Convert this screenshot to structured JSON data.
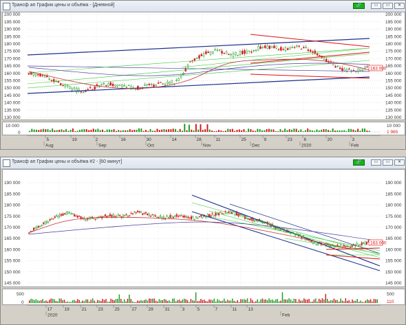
{
  "window1": {
    "title": "Трансф ап График цены и объёма - [Дневной]",
    "buttons": {
      "link": "🔗",
      "min": "▭",
      "restore": "▭",
      "close": "✕"
    },
    "price_ticks": [
      "200 000",
      "195 000",
      "190 000",
      "185 000",
      "180 000",
      "175 000",
      "170 000",
      "165 000",
      "160 000",
      "155 000",
      "150 000",
      "145 000",
      "140 000",
      "135 000",
      "130 000"
    ],
    "price_tag": "163 000",
    "volume_ticks": [
      "10 000",
      "0"
    ],
    "volume_tag": "1 965",
    "day_ticks": [
      "5",
      "19",
      "2",
      "16",
      "30",
      "14",
      "28",
      "11",
      "25",
      "9",
      "23",
      "6",
      "20",
      "3"
    ],
    "month_ticks": [
      "Aug",
      "Sep",
      "Oct",
      "Nov",
      "Dec",
      "2020",
      "Feb"
    ]
  },
  "window2": {
    "title": "Трансф ап График цены и объёма #2 - [60 минут]",
    "buttons": {
      "link": "🔗",
      "min": "▭",
      "restore": "▭",
      "close": "✕"
    },
    "price_ticks": [
      "190 000",
      "185 000",
      "180 000",
      "175 000",
      "170 000",
      "165 000",
      "160 000",
      "155 000",
      "150 000",
      "145 000"
    ],
    "price_tag": "163 000",
    "volume_ticks": [
      "500",
      "0"
    ],
    "volume_tag": "110",
    "day_ticks": [
      "17",
      "19",
      "21",
      "23",
      "25",
      "27",
      "29",
      "31",
      "3",
      "5",
      "7",
      "11",
      "13"
    ],
    "month_ticks": [
      "2020",
      "Feb"
    ]
  },
  "colors": {
    "candle_up": "#1e9a1e",
    "candle_down": "#d01a1a",
    "trend_blue": "#1a2f8a",
    "trend_red": "#e01010",
    "trend_green": "#36c836",
    "ma_purple": "#4a3aa0",
    "ma_red": "#c43030",
    "link_button": "#19b219"
  }
}
